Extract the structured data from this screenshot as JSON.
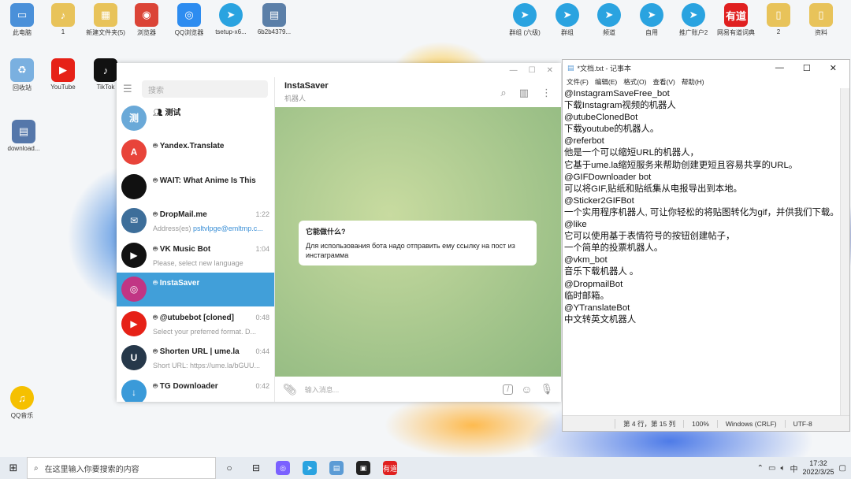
{
  "desktop": {
    "top_icons": [
      {
        "label": "此电脑",
        "color": "#4a90d9",
        "glyph": "▭",
        "icon": "computer-icon"
      },
      {
        "label": "1",
        "color": "#e8c35a",
        "glyph": "♪",
        "icon": "file-icon"
      },
      {
        "label": "新建文件夹(5)",
        "color": "#e8c35a",
        "glyph": "▦",
        "icon": "folder-icon"
      },
      {
        "label": "浏览器",
        "color": "#db4437",
        "glyph": "◉",
        "icon": "browser-icon"
      },
      {
        "label": "QQ浏览器",
        "color": "#2d8cf0",
        "glyph": "◎",
        "icon": "qq-browser-icon"
      },
      {
        "label": "tsetup-x6...",
        "color": "#2aa3e0",
        "glyph": "➤",
        "icon": "telegram-setup-icon"
      },
      {
        "label": "6b2b4379...",
        "color": "#5b7fa8",
        "glyph": "▤",
        "icon": "image-file-icon"
      }
    ],
    "right_icons": [
      {
        "label": "群组 (六级)",
        "color": "#2aa3e0",
        "glyph": "➤",
        "icon": "telegram-icon"
      },
      {
        "label": "群组",
        "color": "#2aa3e0",
        "glyph": "➤",
        "icon": "telegram-icon"
      },
      {
        "label": "频道",
        "color": "#2aa3e0",
        "glyph": "➤",
        "icon": "telegram-icon"
      },
      {
        "label": "自用",
        "color": "#2aa3e0",
        "glyph": "➤",
        "icon": "telegram-icon"
      },
      {
        "label": "推广账户2",
        "color": "#2aa3e0",
        "glyph": "➤",
        "icon": "telegram-icon"
      },
      {
        "label": "网易有道词典",
        "color": "#e02020",
        "glyph": "有道",
        "icon": "youdao-icon"
      },
      {
        "label": "2",
        "color": "#e8c35a",
        "glyph": "▯",
        "icon": "file-icon"
      },
      {
        "label": "资料",
        "color": "#e8c35a",
        "glyph": "▯",
        "icon": "folder-icon"
      }
    ],
    "left_icons": [
      {
        "label": "回收站",
        "color": "#7ab0e0",
        "glyph": "♻",
        "icon": "recycle-bin-icon"
      },
      {
        "label": "YouTube",
        "color": "#e62117",
        "glyph": "▶",
        "icon": "youtube-icon"
      },
      {
        "label": "TikTok",
        "color": "#111111",
        "glyph": "♪",
        "icon": "tiktok-icon"
      }
    ],
    "download_icon": {
      "label": "download...",
      "color": "#5577aa",
      "glyph": "▤"
    },
    "qq_music_icon": {
      "label": "QQ音乐",
      "color": "#f5c000",
      "glyph": "♫"
    }
  },
  "telegram": {
    "search_placeholder": "搜索",
    "chats": [
      {
        "name": "测试",
        "time": "",
        "preview": "",
        "avatar_text": "测",
        "avatar_color": "#6aa9d8",
        "group": true
      },
      {
        "name": "Yandex.Translate",
        "time": "",
        "preview": "",
        "avatar_text": "A",
        "avatar_color": "#e8443a",
        "bot": true
      },
      {
        "name": "WAIT: What Anime Is This",
        "time": "",
        "preview": "",
        "avatar_text": "",
        "avatar_color": "#111111",
        "bot": true
      },
      {
        "name": "DropMail.me",
        "time": "1:22",
        "preview": "Address(es) ",
        "preview_hl": "psltvlpge@emltmp.c...",
        "avatar_text": "✉",
        "avatar_color": "#3d6e9a",
        "bot": true
      },
      {
        "name": "VK Music Bot",
        "time": "1:04",
        "preview": "Please, select new language",
        "avatar_text": "▶",
        "avatar_color": "#111111",
        "bot": true
      },
      {
        "name": "InstaSaver",
        "time": "",
        "preview": "",
        "avatar_text": "◎",
        "avatar_color": "#c13584",
        "bot": true,
        "active": true
      },
      {
        "name": "@utubebot [cloned]",
        "time": "0:48",
        "preview": "Select your preferred format.  D...",
        "avatar_text": "▶",
        "avatar_color": "#e62117",
        "bot": true
      },
      {
        "name": "Shorten URL | ume.la",
        "time": "0:44",
        "preview": "Short URL: https://ume.la/bGUU...",
        "avatar_text": "U",
        "avatar_color": "#26384a",
        "bot": true
      },
      {
        "name": "TG Downloader",
        "time": "0:42",
        "preview": "",
        "avatar_text": "↓",
        "avatar_color": "#3a9ad9",
        "bot": true
      }
    ],
    "chat_header": {
      "title": "InstaSaver",
      "subtitle": "机器人"
    },
    "message": {
      "title": "它能做什么?",
      "body": "Для использования бота надо отправить ему ссылку на пост из инстаграмма"
    },
    "input_placeholder": "输入消息..."
  },
  "notepad": {
    "title": "*文档.txt - 记事本",
    "menu": [
      "文件(F)",
      "编辑(E)",
      "格式(O)",
      "查看(V)",
      "帮助(H)"
    ],
    "lines": [
      "@InstagramSaveFree_bot",
      "下载Instagram视频的机器人",
      "@utubeClonedBot",
      "下载youtube的机器人。",
      "@referbot",
      "他是一个可以缩短URL的机器人，",
      "它基于ume.la缩短服务来帮助创建更短且容易共享的URL。",
      "@GIFDownloader bot",
      "可以将GIF,贴纸和贴纸集从电报导出到本地。",
      "@Sticker2GIFBot",
      "一个实用程序机器人, 可让你轻松的将贴图转化为gif，并供我们下载。",
      "@like",
      "它可以使用基于表情符号的按钮创建帖子，",
      "一个简单的投票机器人。",
      "@vkm_bot",
      "音乐下载机器人 。",
      "@DropmailBot",
      "临时邮箱。",
      "@YTranslateBot",
      "中文转英文机器人"
    ],
    "status": {
      "position": "第 4 行，第 15 列",
      "zoom": "100%",
      "eol": "Windows (CRLF)",
      "encoding": "UTF-8"
    }
  },
  "taskbar": {
    "search_placeholder": "在这里输入你要搜索的内容",
    "apps": [
      {
        "icon": "task-view-icon",
        "glyph": "○",
        "color": ""
      },
      {
        "icon": "widgets-icon",
        "glyph": "⊟",
        "color": ""
      },
      {
        "icon": "qq-browser-icon",
        "glyph": "◎",
        "color": "#7b61ff"
      },
      {
        "icon": "telegram-icon",
        "glyph": "➤",
        "color": "#2aa3e0"
      },
      {
        "icon": "notepad-icon",
        "glyph": "▤",
        "color": "#5b9bd5"
      },
      {
        "icon": "camera-icon",
        "glyph": "▣",
        "color": "#222222"
      },
      {
        "icon": "youdao-icon",
        "glyph": "有道",
        "color": "#e02020"
      }
    ],
    "ime": "中",
    "time": "17:32",
    "date": "2022/3/25"
  }
}
